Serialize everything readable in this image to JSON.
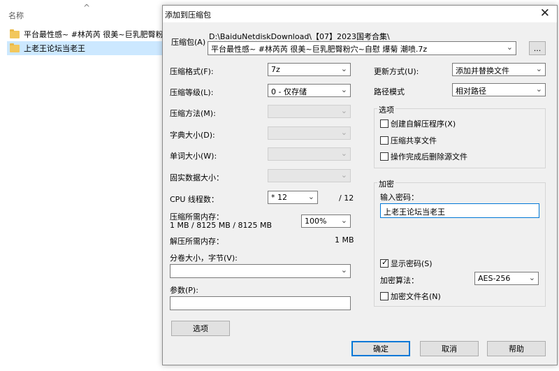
{
  "explorer": {
    "column_header": "名称",
    "files": [
      {
        "name": "平台最性感~ #林芮芮 很美~巨乳肥臀粉...",
        "selected": false
      },
      {
        "name": "上老王论坛当老王",
        "selected": true
      }
    ]
  },
  "dialog": {
    "title": "添加到压缩包",
    "archive_label": "压缩包(A)",
    "archive_path": "D:\\BaiduNetdiskDownload\\【07】2023国考合集\\",
    "archive_name": "平台最性感~ #林芮芮 很美~巨乳肥臀粉穴~自慰 爆菊 潮喷.7z",
    "browse_label": "...",
    "format_label": "压缩格式(F):",
    "format_value": "7z",
    "level_label": "压缩等级(L):",
    "level_value": "0 - 仅存储",
    "method_label": "压缩方法(M):",
    "dict_label": "字典大小(D):",
    "word_label": "单词大小(W):",
    "solid_label": "固实数据大小：",
    "cpu_label": "CPU 线程数：",
    "cpu_value": "* 12",
    "cpu_total": "/ 12",
    "mem_compress_label": "压缩所需内存：",
    "mem_compress_value": "1 MB / 8125 MB / 8125 MB",
    "mem_percent": "100%",
    "mem_decompress_label": "解压所需内存：",
    "mem_decompress_value": "1 MB",
    "split_label": "分卷大小，字节(V):",
    "split_value": "",
    "params_label": "参数(P):",
    "params_value": "",
    "options_button": "选项",
    "update_label": "更新方式(U):",
    "update_value": "添加并替换文件",
    "path_label": "路径模式",
    "path_value": "相对路径",
    "options_group": {
      "title": "选项",
      "sfx": "创建自解压程序(X)",
      "shared": "压缩共享文件",
      "delete": "操作完成后删除源文件"
    },
    "encryption_group": {
      "title": "加密",
      "password_label": "输入密码：",
      "password_value": "上老王论坛当老王",
      "show_password": "显示密码(S)",
      "algo_label": "加密算法：",
      "algo_value": "AES-256",
      "encrypt_names": "加密文件名(N)"
    },
    "ok_button": "确定",
    "cancel_button": "取消",
    "help_button": "帮助"
  }
}
